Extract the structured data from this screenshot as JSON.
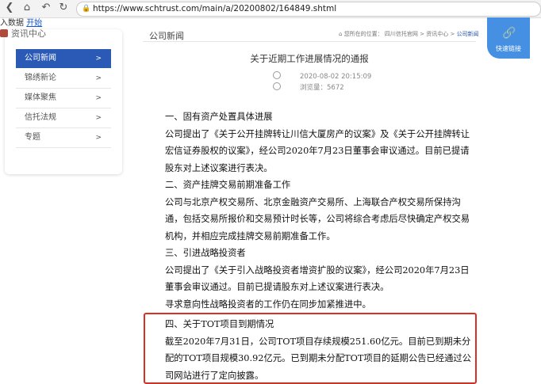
{
  "browser": {
    "url": "https://www.schtrust.com/main/a/20200802/164849.shtml",
    "bookmark_prefix": "入数据",
    "bookmark_link": "开始"
  },
  "sidebar": {
    "header": "资讯中心",
    "items": [
      {
        "label": "公司新闻",
        "arrow": ">"
      },
      {
        "label": "锦绣新论",
        "arrow": ">"
      },
      {
        "label": "媒体聚焦",
        "arrow": ">"
      },
      {
        "label": "信托法规",
        "arrow": ">"
      },
      {
        "label": "专题",
        "arrow": ">"
      }
    ]
  },
  "header": {
    "section": "公司新闻",
    "breadcrumb_label": "您所在的位置：",
    "breadcrumb": "四川信托官网 > 资讯中心 > ",
    "breadcrumb_current": "公司新闻"
  },
  "quick_link": {
    "label": "快速链接"
  },
  "article": {
    "title": "关于近期工作进展情况的通报",
    "date": "2020-08-02 20:15:09",
    "views_label": "浏览量：",
    "views": "5672",
    "sec1_title": "一、固有资产处置具体进展",
    "sec1_body": "公司提出了《关于公开挂牌转让川信大厦房产的议案》及《关于公开挂牌转让宏信证券股权的议案》，经公司2020年7月23日董事会审议通过。目前已提请股东对上述议案进行表决。",
    "sec2_title": "二、资产挂牌交易前期准备工作",
    "sec2_body": "公司与北京产权交易所、北京金融资产交易所、上海联合产权交易所保持沟通，包括交易所报价和交易预计时长等，公司将综合考虑后尽快确定产权交易机构，并相应完成挂牌交易前期准备工作。",
    "sec3_title": "三、引进战略投资者",
    "sec3_body": "公司提出了《关于引入战略投资者增资扩股的议案》，经公司2020年7月23日董事会审议通过。目前已提请股东对上述议案进行表决。",
    "sec3_body2": "寻求意向性战略投资者的工作仍在同步加紧推进中。",
    "sec4_title": "四、关于TOT项目到期情况",
    "sec4_body": "截至2020年7月31日，公司TOT项目存续规模251.60亿元。目前已到期未分配的TOT项目规模30.92亿元。已到期未分配TOT项目的延期公告已经通过公司网站进行了定向披露。"
  }
}
